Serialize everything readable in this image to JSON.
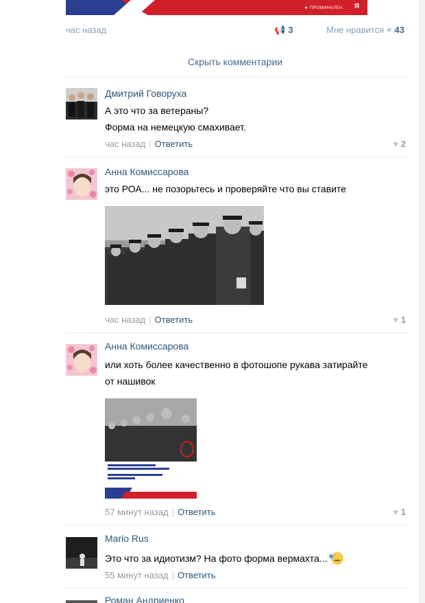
{
  "post": {
    "time": "час назад",
    "shares": "3",
    "likes_label": "Мне нравится",
    "likes": "43"
  },
  "hide_comments": "Скрыть комментарии",
  "banner": {
    "small_text": "★ ПРОМИНАЛЕН.",
    "logo": "Я"
  },
  "comments": [
    {
      "author": "Дмитрий Говоруха",
      "lines": [
        "А это что за ветераны?",
        "Форма на немецкую смахивает."
      ],
      "time": "час назад",
      "reply": "Ответить",
      "likes": "2"
    },
    {
      "author": "Анна Комиссарова",
      "lines": [
        "это РОА... не позорьтесь и проверяйте что вы ставите"
      ],
      "time": "час назад",
      "reply": "Ответить",
      "likes": "1"
    },
    {
      "author": "Анна Комиссарова",
      "lines": [
        "или хоть более качественно в фотошопе рукава затирайте",
        "от нашивок"
      ],
      "time": "57 минут назад",
      "reply": "Ответить",
      "likes": "1"
    },
    {
      "author": "Mario Rus",
      "lines": [
        "Это что за идиотизм? На фото форма вермахта..."
      ],
      "time": "55 минут назад",
      "reply": "Ответить",
      "likes": ""
    },
    {
      "author": "Роман Андриенко",
      "lines": [],
      "time": "",
      "reply": "",
      "likes": ""
    }
  ],
  "colors": {
    "link": "#2b587a",
    "meta": "#999999",
    "accent_red": "#d0202a",
    "accent_blue": "#2a3f8f"
  }
}
